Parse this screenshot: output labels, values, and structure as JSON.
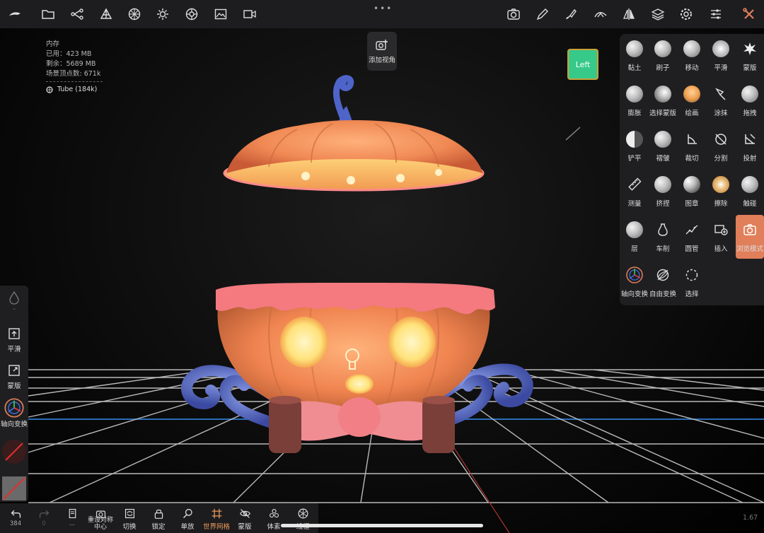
{
  "stats": {
    "title": "内存",
    "used": "已用：423 MB",
    "remaining": "剩余：5689 MB",
    "vertices": "场景顶点数: 671k",
    "mesh": "Tube (184k)"
  },
  "add_view": "添加视角",
  "view_cube": "Left",
  "tools": [
    {
      "label": "黏土",
      "icon": "clay-brush-icon"
    },
    {
      "label": "刷子",
      "icon": "brush-icon"
    },
    {
      "label": "移动",
      "icon": "move-brush-icon"
    },
    {
      "label": "平滑",
      "icon": "smooth-brush-icon"
    },
    {
      "label": "蒙版",
      "icon": "mask-brush-icon"
    },
    {
      "label": "膨胀",
      "icon": "inflate-brush-icon"
    },
    {
      "label": "选择蒙版",
      "icon": "select-mask-icon"
    },
    {
      "label": "绘画",
      "icon": "paint-brush-icon"
    },
    {
      "label": "涂抹",
      "icon": "smudge-icon"
    },
    {
      "label": "拖拽",
      "icon": "drag-brush-icon"
    },
    {
      "label": "铲平",
      "icon": "flatten-brush-icon"
    },
    {
      "label": "褶皱",
      "icon": "crease-brush-icon"
    },
    {
      "label": "裁切",
      "icon": "trim-icon"
    },
    {
      "label": "分割",
      "icon": "split-icon"
    },
    {
      "label": "投射",
      "icon": "project-icon"
    },
    {
      "label": "测量",
      "icon": "ruler-icon"
    },
    {
      "label": "挤捏",
      "icon": "pinch-brush-icon"
    },
    {
      "label": "图章",
      "icon": "stamp-icon"
    },
    {
      "label": "擦除",
      "icon": "erase-icon"
    },
    {
      "label": "触碰",
      "icon": "tweak-icon"
    },
    {
      "label": "层",
      "icon": "layer-brush-icon"
    },
    {
      "label": "车削",
      "icon": "lathe-icon"
    },
    {
      "label": "圆管",
      "icon": "tube-icon"
    },
    {
      "label": "插入",
      "icon": "insert-icon"
    },
    {
      "label": "浏览模式",
      "icon": "camera-icon"
    },
    {
      "label": "轴向变换",
      "icon": "gizmo-icon"
    },
    {
      "label": "自由变换",
      "icon": "free-transform-icon"
    },
    {
      "label": "选择",
      "icon": "select-icon"
    }
  ],
  "left_panel": {
    "smooth": "平滑",
    "mask": "蒙版",
    "gizmo": "轴向变换",
    "dash": "-"
  },
  "bottom": {
    "undo_count": "384",
    "redo_count": "0",
    "more": "...",
    "reset_symmetry": "重设对称中心",
    "toggle": "切换",
    "lock": "锁定",
    "single": "单放",
    "world_grid": "世界网格",
    "mask": "蒙版",
    "voxel": "体素",
    "wireframe": "线框"
  },
  "version": "1.67",
  "colors": {
    "accent": "#e07f5a",
    "panel": "#1f1f21",
    "viewcube": "#36c98a",
    "grid_axis": "#2f7fd6"
  }
}
